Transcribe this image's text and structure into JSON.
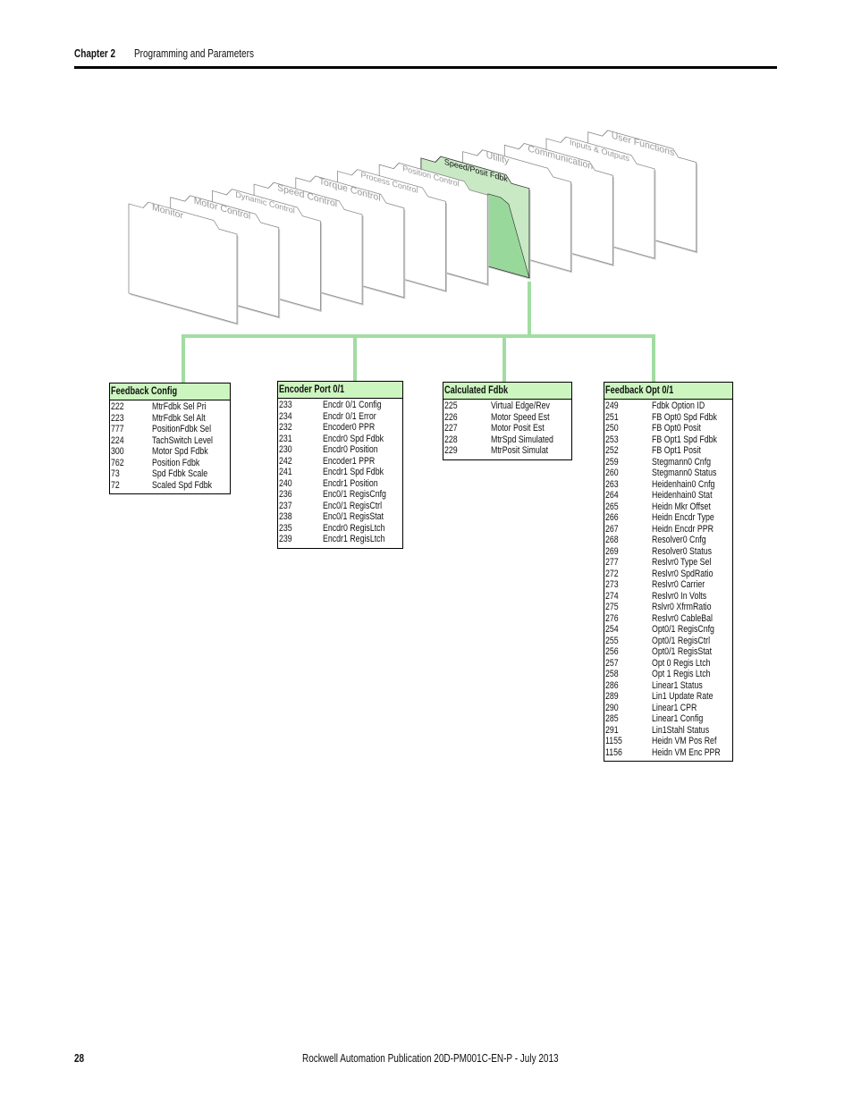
{
  "header": {
    "chapter": "Chapter 2",
    "title": "Programming and Parameters"
  },
  "footer": {
    "page": "28",
    "publication": "Rockwell Automation Publication 20D-PM001C-EN-P - July 2013"
  },
  "colors": {
    "highlight_folder": "#c9e9c5",
    "highlight_inner": "#98d99b",
    "connector": "#a2dca2",
    "table_header": "#ccf5c0"
  },
  "folders": [
    {
      "label": "Monitor"
    },
    {
      "label": "Motor Control"
    },
    {
      "label": "Dynamic Control"
    },
    {
      "label": "Speed Control"
    },
    {
      "label": "Torque Control"
    },
    {
      "label": "Process Control"
    },
    {
      "label": "Position Control"
    },
    {
      "label": "Speed/Posit Fdbk",
      "selected": true
    },
    {
      "label": "Utility"
    },
    {
      "label": "Communication"
    },
    {
      "label": "Inputs & Outputs"
    },
    {
      "label": "User Functions"
    }
  ],
  "tables": [
    {
      "title": "Feedback Config",
      "rows": [
        [
          "222",
          "MtrFdbk Sel Pri"
        ],
        [
          "223",
          "MtrFdbk Sel Alt"
        ],
        [
          "777",
          "PositionFdbk Sel"
        ],
        [
          "224",
          "TachSwitch Level"
        ],
        [
          "300",
          "Motor Spd Fdbk"
        ],
        [
          "762",
          "Position Fdbk"
        ],
        [
          "73",
          "Spd Fdbk Scale"
        ],
        [
          "72",
          "Scaled Spd Fdbk"
        ]
      ]
    },
    {
      "title": "Encoder Port 0/1",
      "rows": [
        [
          "233",
          "Encdr 0/1 Config"
        ],
        [
          "234",
          "Encdr 0/1 Error"
        ],
        [
          "232",
          "Encoder0 PPR"
        ],
        [
          "231",
          "Encdr0 Spd Fdbk"
        ],
        [
          "230",
          "Encdr0 Position"
        ],
        [
          "242",
          "Encoder1 PPR"
        ],
        [
          "241",
          "Encdr1 Spd Fdbk"
        ],
        [
          "240",
          "Encdr1 Position"
        ],
        [
          "236",
          "Enc0/1 RegisCnfg"
        ],
        [
          "237",
          "Enc0/1 RegisCtrl"
        ],
        [
          "238",
          "Enc0/1 RegisStat"
        ],
        [
          "235",
          "Encdr0 RegisLtch"
        ],
        [
          "239",
          "Encdr1 RegisLtch"
        ]
      ]
    },
    {
      "title": "Calculated Fdbk",
      "rows": [
        [
          "225",
          "Virtual Edge/Rev"
        ],
        [
          "226",
          "Motor Speed Est"
        ],
        [
          "227",
          "Motor Posit Est"
        ],
        [
          "228",
          "MtrSpd Simulated"
        ],
        [
          "229",
          "MtrPosit Simulat"
        ]
      ]
    },
    {
      "title": "Feedback Opt 0/1",
      "rows": [
        [
          "249",
          "Fdbk Option ID"
        ],
        [
          "251",
          "FB Opt0 Spd Fdbk"
        ],
        [
          "250",
          "FB Opt0 Posit"
        ],
        [
          "253",
          "FB Opt1 Spd Fdbk"
        ],
        [
          "252",
          "FB Opt1 Posit"
        ],
        [
          "259",
          "Stegmann0 Cnfg"
        ],
        [
          "260",
          "Stegmann0 Status"
        ],
        [
          "263",
          "Heidenhain0 Cnfg"
        ],
        [
          "264",
          "Heidenhain0 Stat"
        ],
        [
          "265",
          "Heidn Mkr Offset"
        ],
        [
          "266",
          "Heidn Encdr Type"
        ],
        [
          "267",
          "Heidn Encdr PPR"
        ],
        [
          "268",
          "Resolver0 Cnfg"
        ],
        [
          "269",
          "Resolver0 Status"
        ],
        [
          "277",
          "Reslvr0 Type Sel"
        ],
        [
          "272",
          "Reslvr0 SpdRatio"
        ],
        [
          "273",
          "Reslvr0 Carrier"
        ],
        [
          "274",
          "Reslvr0 In Volts"
        ],
        [
          "275",
          "Rslvr0 XfrmRatio"
        ],
        [
          "276",
          "Reslvr0 CableBal"
        ],
        [
          "254",
          "Opt0/1 RegisCnfg"
        ],
        [
          "255",
          "Opt0/1 RegisCtrl"
        ],
        [
          "256",
          "Opt0/1 RegisStat"
        ],
        [
          "257",
          "Opt 0 Regis Ltch"
        ],
        [
          "258",
          "Opt 1 Regis Ltch"
        ],
        [
          "286",
          "Linear1 Status"
        ],
        [
          "289",
          "Lin1 Update Rate"
        ],
        [
          "290",
          "Linear1 CPR"
        ],
        [
          "285",
          "Linear1 Config"
        ],
        [
          "291",
          "Lin1Stahl Status"
        ],
        [
          "1155",
          "Heidn VM Pos Ref"
        ],
        [
          "1156",
          "Heidn VM Enc PPR"
        ]
      ]
    }
  ]
}
